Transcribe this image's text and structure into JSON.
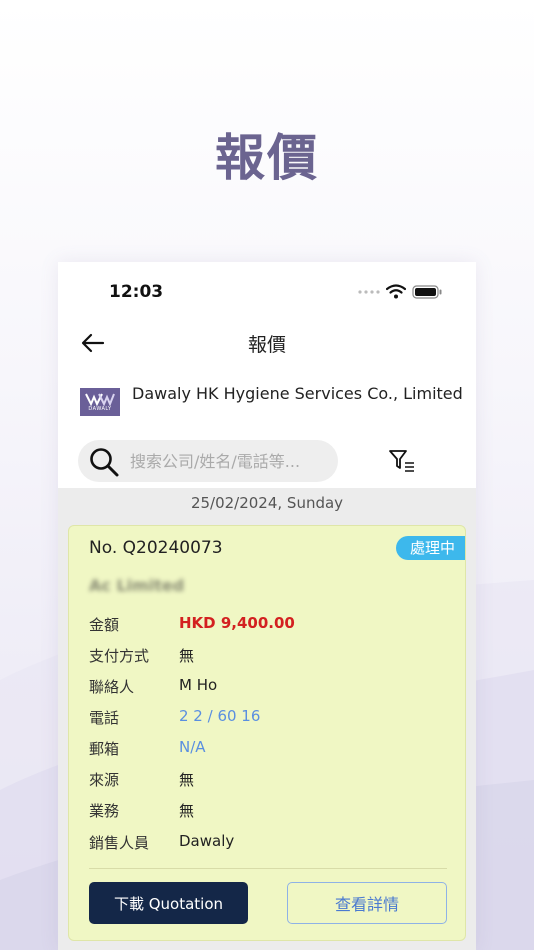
{
  "hero": {
    "title": "報價"
  },
  "status_bar": {
    "time": "12:03"
  },
  "nav": {
    "title": "報價"
  },
  "company": {
    "name": "Dawaly HK Hygiene Services Co., Limited",
    "logo_text": "DAWALY"
  },
  "search": {
    "placeholder": "搜索公司/姓名/電話等..."
  },
  "list": {
    "date_header": "25/02/2024, Sunday",
    "card": {
      "number": "No. Q20240073",
      "status": "處理中",
      "company": "Ac          Limited",
      "fields": [
        {
          "label": "金額",
          "value": "HKD 9,400.00"
        },
        {
          "label": "支付方式",
          "value": "無"
        },
        {
          "label": "聯絡人",
          "value": "M        Ho"
        },
        {
          "label": "電話",
          "value": "2        2 / 60        16"
        },
        {
          "label": "郵箱",
          "value": "N/A"
        },
        {
          "label": "來源",
          "value": "無"
        },
        {
          "label": "業務",
          "value": "無"
        },
        {
          "label": "銷售人員",
          "value": "Dawaly"
        }
      ],
      "download_label": "下載 Quotation",
      "details_label": "查看詳情"
    }
  },
  "colors": {
    "hero_title": "#6b6490",
    "card_bg": "#f0f7c4",
    "badge": "#3db8ec",
    "amount": "#d32020",
    "primary_button": "#142748",
    "link": "#5a8fe0"
  }
}
